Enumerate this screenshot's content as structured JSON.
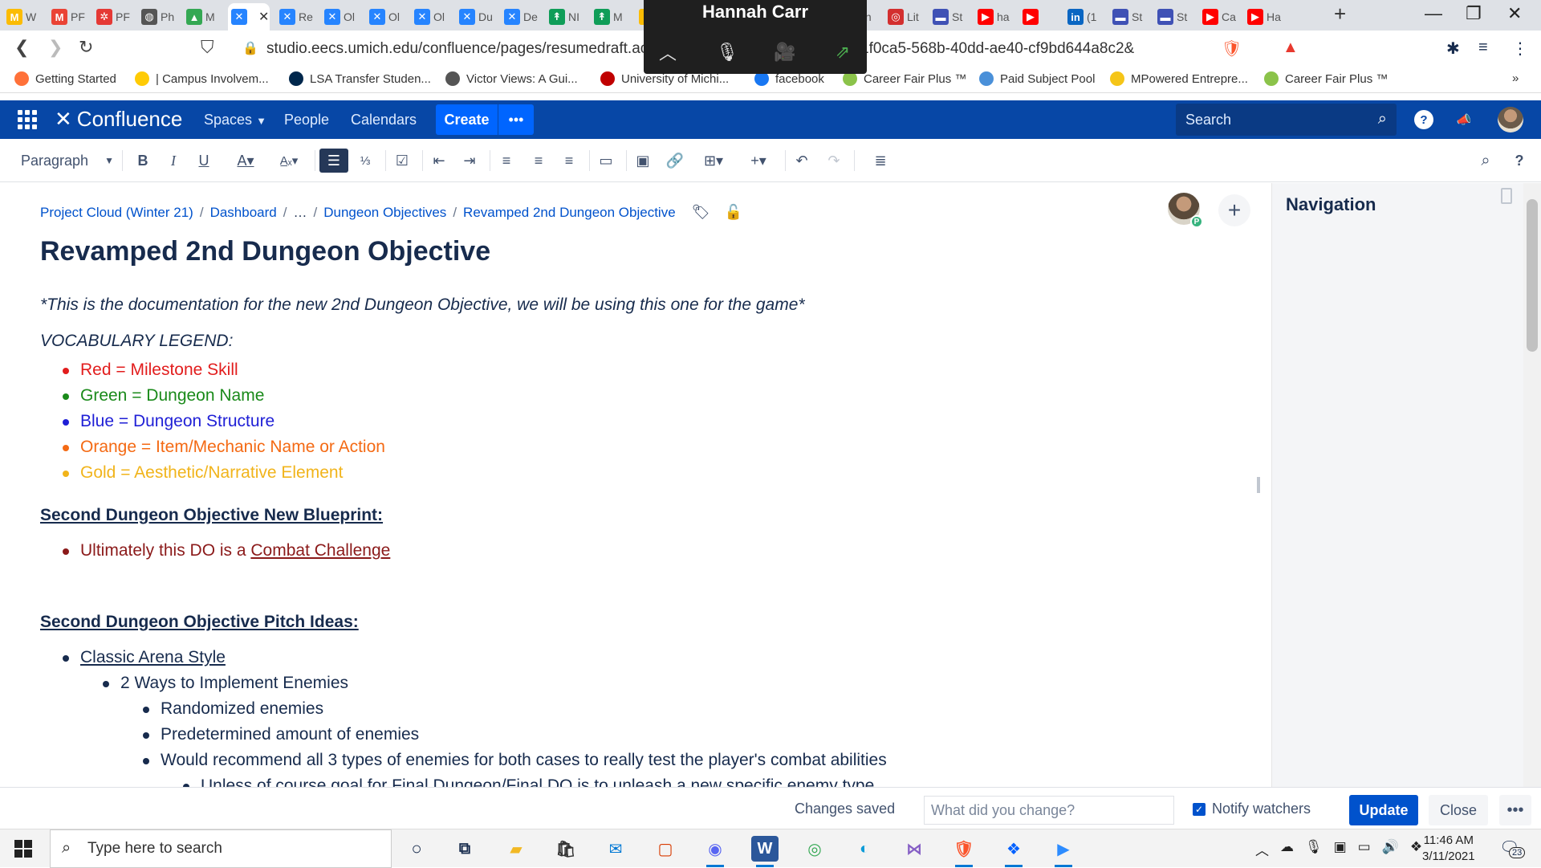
{
  "browser": {
    "tabs": [
      {
        "label": "W",
        "icon_color": "#fbbc04",
        "icon_glyph": "M"
      },
      {
        "label": "PF",
        "icon_color": "#ea4335",
        "icon_glyph": "M"
      },
      {
        "label": "PF",
        "icon_color": "#e53935",
        "icon_glyph": "✲"
      },
      {
        "label": "Ph",
        "icon_color": "#555555",
        "icon_glyph": "◍"
      },
      {
        "label": "M",
        "icon_color": "#34a853",
        "icon_glyph": "▲"
      },
      {
        "label": "",
        "icon_color": "#2684ff",
        "icon_glyph": "✕",
        "active": true
      },
      {
        "label": "Re",
        "icon_color": "#2684ff",
        "icon_glyph": "✕"
      },
      {
        "label": "Ol",
        "icon_color": "#2684ff",
        "icon_glyph": "✕"
      },
      {
        "label": "Ol",
        "icon_color": "#2684ff",
        "icon_glyph": "✕"
      },
      {
        "label": "Ol",
        "icon_color": "#2684ff",
        "icon_glyph": "✕"
      },
      {
        "label": "Du",
        "icon_color": "#2684ff",
        "icon_glyph": "✕"
      },
      {
        "label": "De",
        "icon_color": "#2684ff",
        "icon_glyph": "✕"
      },
      {
        "label": "NI",
        "icon_color": "#0f9d58",
        "icon_glyph": "↟"
      },
      {
        "label": "M",
        "icon_color": "#0f9d58",
        "icon_glyph": "↟"
      },
      {
        "label": "",
        "icon_color": "#fbbc04",
        "icon_glyph": "▲"
      },
      {
        "label": "NI",
        "icon_color": "#888888",
        "icon_glyph": ""
      },
      {
        "label": "In",
        "icon_color": "#ea4335",
        "icon_glyph": "M"
      },
      {
        "label": "Lit",
        "icon_color": "#d32f2f",
        "icon_glyph": "◎"
      },
      {
        "label": "St",
        "icon_color": "#3f51b5",
        "icon_glyph": "▬"
      },
      {
        "label": "ha",
        "icon_color": "#ff0000",
        "icon_glyph": "▶"
      },
      {
        "label": "",
        "icon_color": "#ff0000",
        "icon_glyph": "▶"
      },
      {
        "label": "(1",
        "icon_color": "#0a66c2",
        "icon_glyph": "in"
      },
      {
        "label": "St",
        "icon_color": "#3f51b5",
        "icon_glyph": "▬"
      },
      {
        "label": "St",
        "icon_color": "#3f51b5",
        "icon_glyph": "▬"
      },
      {
        "label": "Ca",
        "icon_color": "#ff0000",
        "icon_glyph": "▶"
      },
      {
        "label": "Ha",
        "icon_color": "#ff0000",
        "icon_glyph": "▶"
      }
    ],
    "url": "studio.eecs.umich.edu/confluence/pages/resumedraft.action?",
    "url_tail": "1f0ca5-568b-40dd-ae40-cf9bd644a8c2&",
    "bookmarks": [
      {
        "label": "Getting Started",
        "color": "#ff7139"
      },
      {
        "label": "| Campus Involvem...",
        "color": "#ffcb05"
      },
      {
        "label": "LSA Transfer Studen...",
        "color": "#00274c"
      },
      {
        "label": "Victor Views: A Gui...",
        "color": "#555555"
      },
      {
        "label": "University of Michi...",
        "color": "#c00000"
      },
      {
        "label": "facebook",
        "color": "#1877f2"
      },
      {
        "label": "Career Fair Plus ™",
        "color": "#8bc34a"
      },
      {
        "label": "Paid Subject Pool",
        "color": "#4a90d9"
      },
      {
        "label": "MPowered Entrepre...",
        "color": "#f5c518"
      },
      {
        "label": "Career Fair Plus ™",
        "color": "#8bc34a"
      }
    ],
    "more_bookmarks": "»"
  },
  "zoom": {
    "name": "Hannah Carr"
  },
  "confluence": {
    "logo_text": "Confluence",
    "nav": {
      "spaces": "Spaces",
      "people": "People",
      "calendars": "Calendars"
    },
    "create_label": "Create",
    "create_more": "•••",
    "search_placeholder": "Search"
  },
  "toolbar": {
    "paragraph_style": "Paragraph"
  },
  "page": {
    "breadcrumbs": [
      "Project Cloud (Winter 21)",
      "Dashboard",
      "…",
      "Dungeon Objectives",
      "Revamped 2nd Dungeon Objective"
    ],
    "title": "Revamped 2nd Dungeon Objective",
    "intro": "*This is the documentation for the new 2nd Dungeon Objective, we will be using this one for the game*",
    "legend_title": "VOCABULARY LEGEND:",
    "legend": [
      {
        "text": "Red = Milestone Skill",
        "color": "#e21d1d"
      },
      {
        "text": "Green = Dungeon Name",
        "color": "#1a8a1a"
      },
      {
        "text": "Blue = Dungeon Structure",
        "color": "#1f1fd6"
      },
      {
        "text": "Orange = Item/Mechanic Name or Action",
        "color": "#f46a14"
      },
      {
        "text": "Gold = Aesthetic/Narrative Element",
        "color": "#f1b41b"
      }
    ],
    "blueprint_heading": "Second Dungeon Objective New Blueprint:",
    "blueprint_item_prefix": "Ultimately this DO is a ",
    "blueprint_item_link": "Combat Challenge",
    "pitch_heading": "Second Dungeon Objective Pitch Ideas:",
    "pitch": {
      "item1": "Classic Arena Style",
      "item1_1": "2 Ways to Implement Enemies",
      "item1_1_a": "Randomized enemies",
      "item1_1_b": "Predetermined amount of enemies",
      "item1_1_c": "Would recommend all 3 types of enemies for both cases to really test the player's combat abilities",
      "item1_1_c_i": "Unless of course goal for Final Dungeon/Final DO is to unleash a new specific enemy type"
    },
    "presence_initial": "P"
  },
  "nav_panel": {
    "title": "Navigation"
  },
  "footer": {
    "status": "Changes saved",
    "change_placeholder": "What did you change?",
    "notify_label": "Notify watchers",
    "notify_checked": true,
    "update_label": "Update",
    "close_label": "Close",
    "more_label": "•••"
  },
  "taskbar": {
    "search_placeholder": "Type here to search",
    "time": "11:46 AM",
    "date": "3/11/2021",
    "notification_count": "23"
  }
}
